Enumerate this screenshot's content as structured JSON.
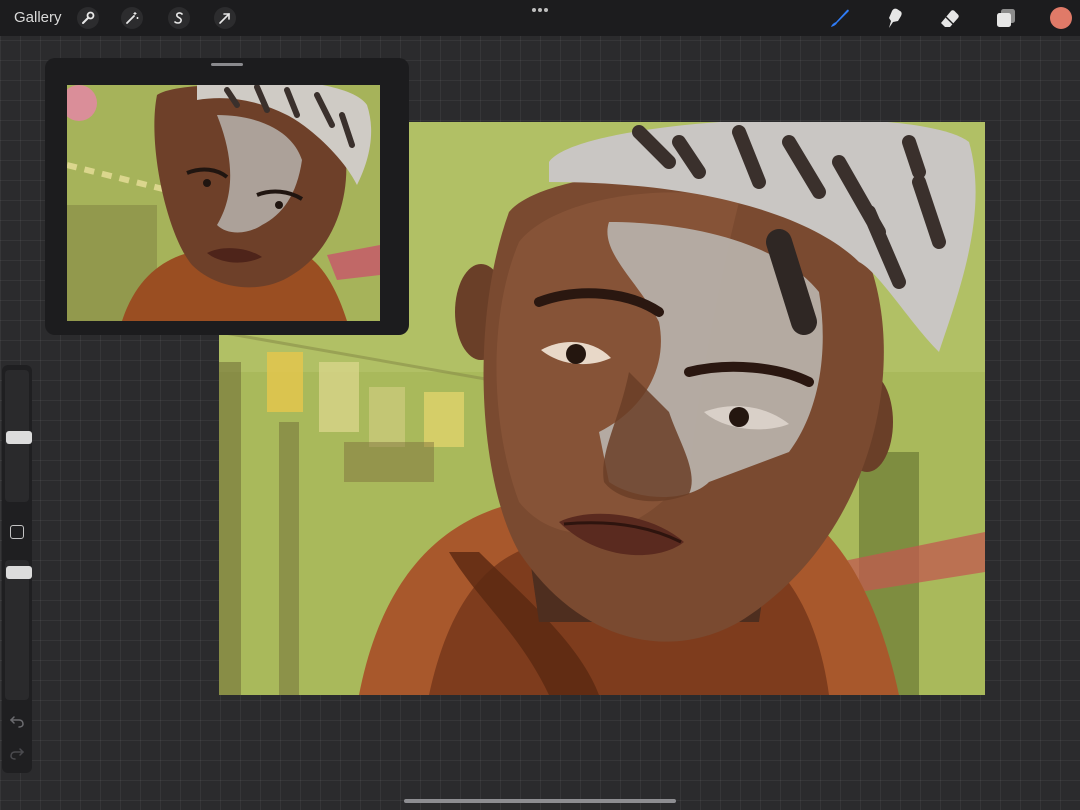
{
  "topbar": {
    "gallery_label": "Gallery",
    "left_tools": [
      "wrench-icon",
      "magic-wand-icon",
      "selection-s-icon",
      "transform-arrow-icon"
    ],
    "more_menu_icon": "ellipsis-icon",
    "right_tools": [
      "brush-icon",
      "smudge-icon",
      "eraser-icon",
      "layers-icon"
    ],
    "active_tool": "brush-icon",
    "active_tool_color": "#2f7cf6",
    "current_color": "#e07a68"
  },
  "reference_window": {
    "content": "reference-painting-thumbnail"
  },
  "canvas": {
    "content": "digital-portrait-painting"
  },
  "sidebar": {
    "brush_size_level": 0.49,
    "opacity_level": 0.95,
    "undo_icon": "undo-arrow-icon",
    "redo_icon": "redo-arrow-icon"
  }
}
